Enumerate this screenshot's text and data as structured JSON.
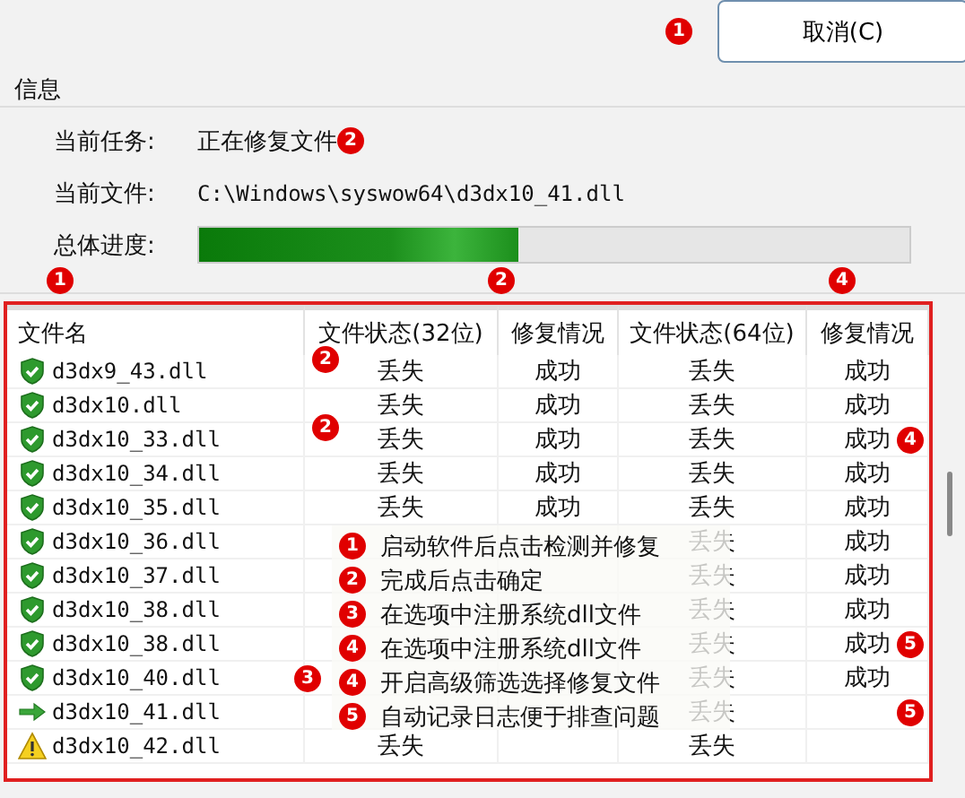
{
  "cancel_button": {
    "label": "取消(C)",
    "marker": "1"
  },
  "info": {
    "title": "信息",
    "task": {
      "label": "当前任务:",
      "value": "正在修复文件",
      "marker": "2"
    },
    "file": {
      "label": "当前文件:",
      "value": "C:\\Windows\\syswow64\\d3dx10_41.dll"
    },
    "progress": {
      "label": "总体进度:",
      "level": 0.45,
      "markers": [
        "1",
        "2",
        "4"
      ]
    }
  },
  "table": {
    "columns": [
      "文件名",
      "文件状态(32位)",
      "修复情况",
      "文件状态(64位)",
      "修复情况"
    ],
    "rows": [
      {
        "kind": "ok",
        "cells": [
          {
            "text": "d3dx9_43.dll"
          },
          {
            "text": "丢失",
            "marker": "2"
          },
          {
            "text": "成功"
          },
          {
            "text": "丢失"
          },
          {
            "text": "成功"
          }
        ]
      },
      {
        "kind": "ok",
        "cells": [
          {
            "text": "d3dx10.dll"
          },
          {
            "text": "丢失"
          },
          {
            "text": "成功"
          },
          {
            "text": "丢失"
          },
          {
            "text": "成功"
          }
        ]
      },
      {
        "kind": "ok",
        "cells": [
          {
            "text": "d3dx10_33.dll"
          },
          {
            "text": "丢失",
            "marker": "2"
          },
          {
            "text": "成功"
          },
          {
            "text": "丢失"
          },
          {
            "text": "成功",
            "marker": "4"
          }
        ]
      },
      {
        "kind": "ok",
        "cells": [
          {
            "text": "d3dx10_34.dll"
          },
          {
            "text": "丢失"
          },
          {
            "text": "成功"
          },
          {
            "text": "丢失"
          },
          {
            "text": "成功"
          }
        ]
      },
      {
        "kind": "ok",
        "cells": [
          {
            "text": "d3dx10_35.dll"
          },
          {
            "text": "丢失"
          },
          {
            "text": "成功"
          },
          {
            "text": "丢失"
          },
          {
            "text": "成功"
          }
        ]
      },
      {
        "kind": "ok",
        "cells": [
          {
            "text": "d3dx10_36.dll"
          },
          "",
          "",
          {
            "text": "丢失"
          },
          {
            "text": "成功"
          }
        ]
      },
      {
        "kind": "ok",
        "cells": [
          {
            "text": "d3dx10_37.dll"
          },
          "",
          "",
          {
            "text": "丢失"
          },
          {
            "text": "成功"
          }
        ]
      },
      {
        "kind": "ok",
        "cells": [
          {
            "text": "d3dx10_38.dll"
          },
          "",
          "",
          {
            "text": "丢失"
          },
          {
            "text": "成功"
          }
        ]
      },
      {
        "kind": "ok",
        "cells": [
          {
            "text": "d3dx10_38.dll"
          },
          "",
          "",
          {
            "text": "丢失"
          },
          {
            "text": "成功",
            "marker": "5"
          }
        ]
      },
      {
        "kind": "ok",
        "cells": [
          {
            "text": "d3dx10_40.dll",
            "marker": "3"
          },
          "",
          "",
          {
            "text": "丢失"
          },
          {
            "text": "成功"
          }
        ]
      },
      {
        "kind": "current",
        "cells": [
          {
            "text": "d3dx10_41.dll"
          },
          "",
          "",
          {
            "text": "丢失"
          },
          {
            "marker": "5"
          }
        ]
      },
      {
        "kind": "warning",
        "cells": [
          {
            "text": "d3dx10_42.dll"
          },
          {
            "text": "丢失"
          },
          "",
          {
            "text": "丢失"
          },
          ""
        ]
      }
    ]
  },
  "steps": [
    {
      "number": "1",
      "text": "启动软件后点击检测并修复"
    },
    {
      "number": "2",
      "text": "完成后点击确定"
    },
    {
      "number": "3",
      "text": "在选项中注册系统dll文件"
    },
    {
      "number": "4",
      "text": "在选项中注册系统dll文件"
    },
    {
      "number": "4",
      "text": "开启高级筛选选择修复文件"
    },
    {
      "number": "5",
      "text": "自动记录日志便于排查问题"
    }
  ]
}
